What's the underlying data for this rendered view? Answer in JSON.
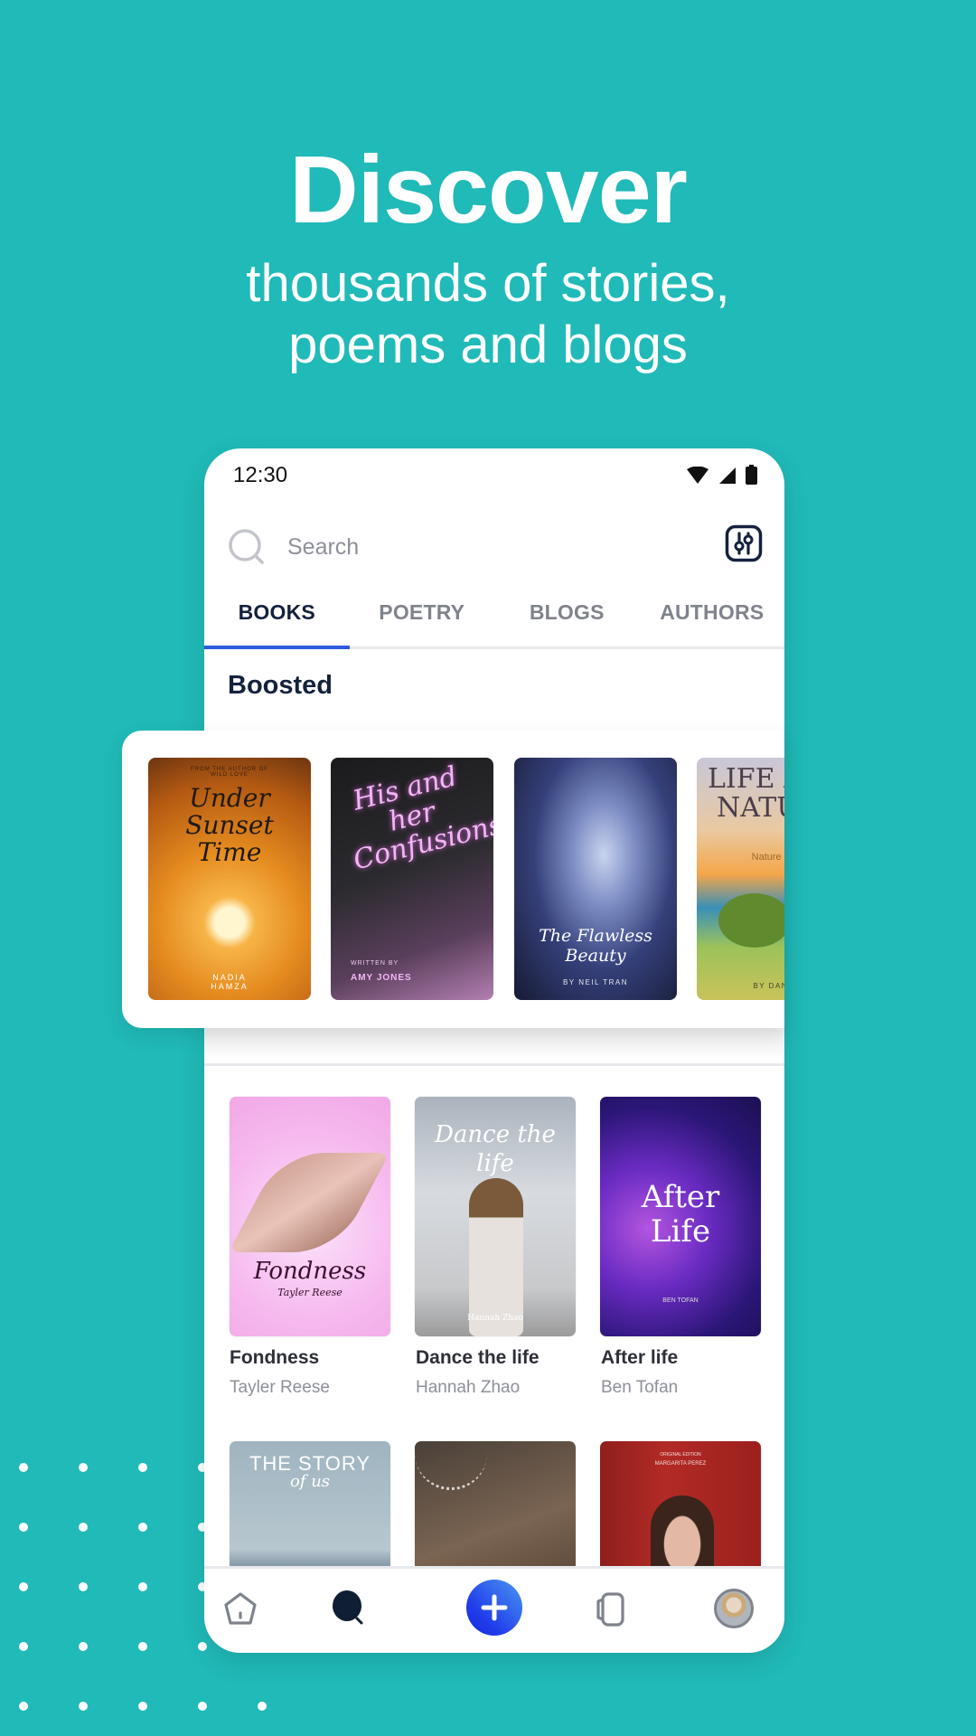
{
  "hero": {
    "title": "Discover",
    "subtitle_line1": "thousands of stories,",
    "subtitle_line2": "poems and blogs"
  },
  "colors": {
    "background": "#20BAB8",
    "accent": "#2F5BE0",
    "text_dark": "#14213D",
    "text_muted": "#80838C"
  },
  "status_bar": {
    "time": "12:30",
    "icons": [
      "wifi-icon",
      "cellular-signal-icon",
      "battery-icon"
    ]
  },
  "search": {
    "placeholder": "Search",
    "value": "",
    "filter_icon": "filter-sliders-icon"
  },
  "tabs": [
    {
      "label": "BOOKS",
      "active": true
    },
    {
      "label": "POETRY",
      "active": false
    },
    {
      "label": "BLOGS",
      "active": false
    },
    {
      "label": "AUTHORS",
      "active": false
    }
  ],
  "boosted": {
    "title": "Boosted",
    "books": [
      {
        "cover_title": "Under Sunset Time",
        "cover_kicker": "FROM THE AUTHOR OF 'WILD LOVE'",
        "cover_author": "NADIA HAMZA"
      },
      {
        "cover_title": "His and her Confusions",
        "cover_kicker": "WRITTEN BY",
        "cover_author": "AMY JONES"
      },
      {
        "cover_title": "The Flawless Beauty",
        "cover_author": "BY NEIL TRAN"
      },
      {
        "cover_title": "LIFE AND NATURE",
        "cover_subtitle": "Nature Bri...",
        "cover_author": "BY DANIEL"
      }
    ]
  },
  "grid": {
    "books": [
      {
        "title": "Fondness",
        "author": "Tayler Reese",
        "cover_title": "Fondness",
        "cover_author": "Tayler Reese"
      },
      {
        "title": "Dance the life",
        "author": "Hannah Zhao",
        "cover_title": "Dance the life",
        "cover_author": "Hannah Zhao"
      },
      {
        "title": "After life",
        "author": "Ben Tofan",
        "cover_title": "After Life",
        "cover_author": "BEN TOFAN"
      },
      {
        "cover_title": "THE STORY",
        "cover_subtitle": "of us"
      },
      {},
      {
        "cover_kicker": "ORIGINAL EDITION",
        "cover_author": "MARGARITA PEREZ"
      }
    ]
  },
  "bottom_nav": [
    {
      "name": "home",
      "icon": "home-icon"
    },
    {
      "name": "search",
      "icon": "search-icon",
      "active": true
    },
    {
      "name": "create",
      "icon": "plus-icon"
    },
    {
      "name": "library",
      "icon": "library-cards-icon"
    },
    {
      "name": "profile",
      "icon": "avatar"
    }
  ]
}
